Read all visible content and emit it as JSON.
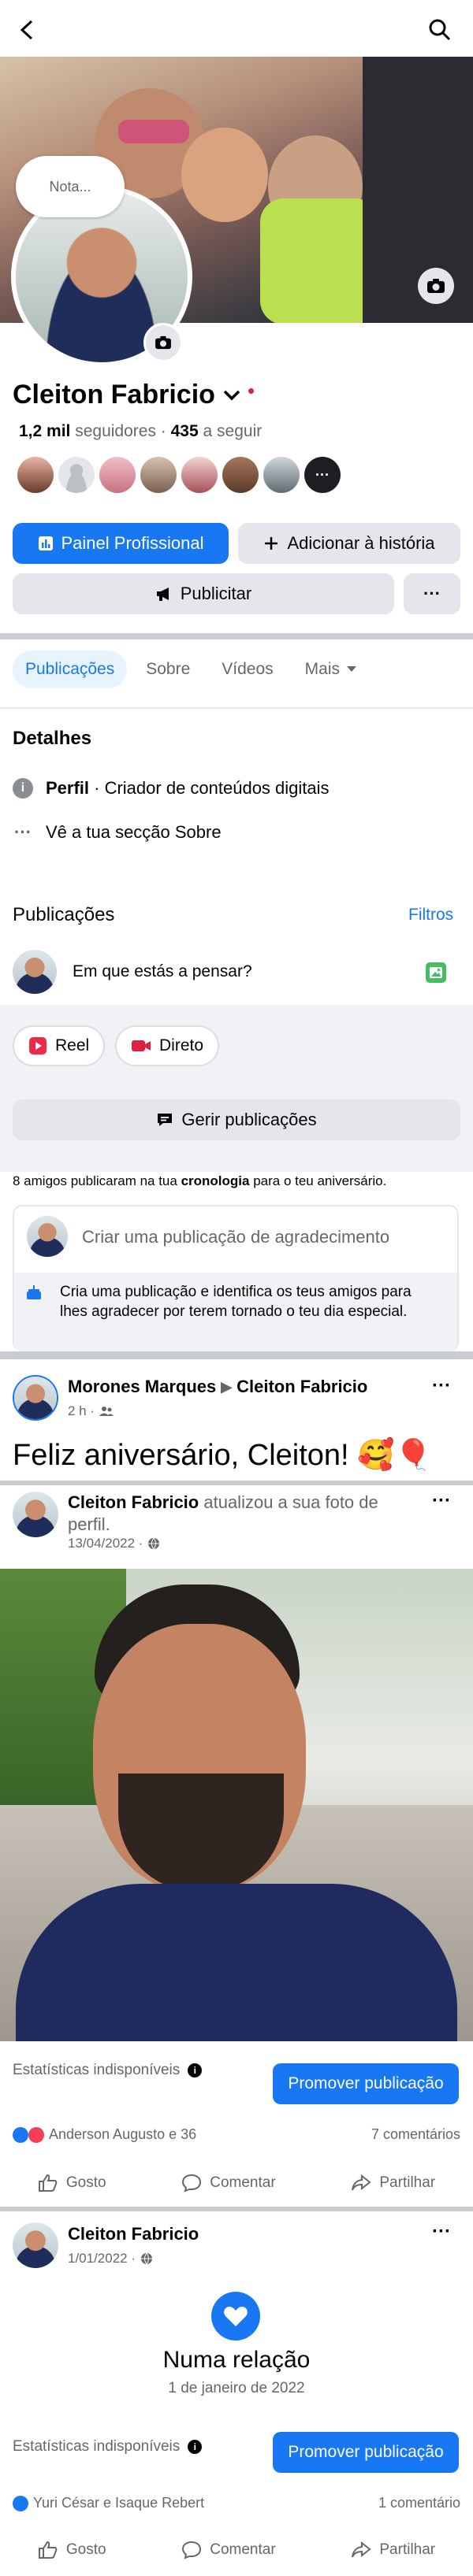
{
  "profile": {
    "name": "Cleiton Fabricio",
    "followers_count": "1,2 mil",
    "followers_label": "seguidores",
    "following_count": "435",
    "following_label": "a seguir",
    "note_bubble": "Nota..."
  },
  "buttons": {
    "pro_panel": "Painel Profissional",
    "add_story": "Adicionar à história",
    "advertise": "Publicitar",
    "more": "···"
  },
  "tabs": [
    "Publicações",
    "Sobre",
    "Vídeos",
    "Mais"
  ],
  "details": {
    "heading": "Detalhes",
    "profile_label": "Perfil",
    "profile_value": " · Criador de conteúdos digitais",
    "about_link": "Vê a tua secção Sobre"
  },
  "posts_section": {
    "heading": "Publicações",
    "filters": "Filtros",
    "composer_placeholder": "Em que estás a pensar?",
    "reel": "Reel",
    "live": "Direto",
    "manage": "Gerir publicações"
  },
  "birthday": {
    "notice_pre": "8 amigos publicaram na tua ",
    "notice_bold": "cronologia",
    "notice_post": " para o teu aniversário.",
    "thanks_placeholder": "Criar uma publicação de agradecimento",
    "thanks_hint": "Cria uma publicação e identifica os teus amigos para lhes agradecer por terem tornado o teu dia especial."
  },
  "post1": {
    "author": "Morones Marques",
    "target": "Cleiton Fabricio",
    "time": "2 h ·",
    "text": "Feliz aniversário, Cleiton! 🥰🎈"
  },
  "post2": {
    "author": "Cleiton Fabricio",
    "action": " atualizou a sua foto de perfil.",
    "date": "13/04/2022 ·",
    "stats_unavailable": "Estatísticas indisponíveis",
    "promote": "Promover publicação",
    "reactions": "Anderson Augusto e 36",
    "comments": "7 comentários",
    "like": "Gosto",
    "comment": "Comentar",
    "share": "Partilhar"
  },
  "post3": {
    "author": "Cleiton Fabricio",
    "date": "1/01/2022 ·",
    "event_title": "Numa relação",
    "event_date": "1 de janeiro de 2022",
    "stats_unavailable": "Estatísticas indisponíveis",
    "promote": "Promover publicação",
    "reactions": "Yuri César e Isaque Rebert",
    "comments": "1 comentário",
    "like": "Gosto",
    "comment": "Comentar",
    "share": "Partilhar"
  },
  "colors": {
    "accent": "#1877f2",
    "grey_button": "#e4e6eb",
    "muted": "#65676b"
  }
}
